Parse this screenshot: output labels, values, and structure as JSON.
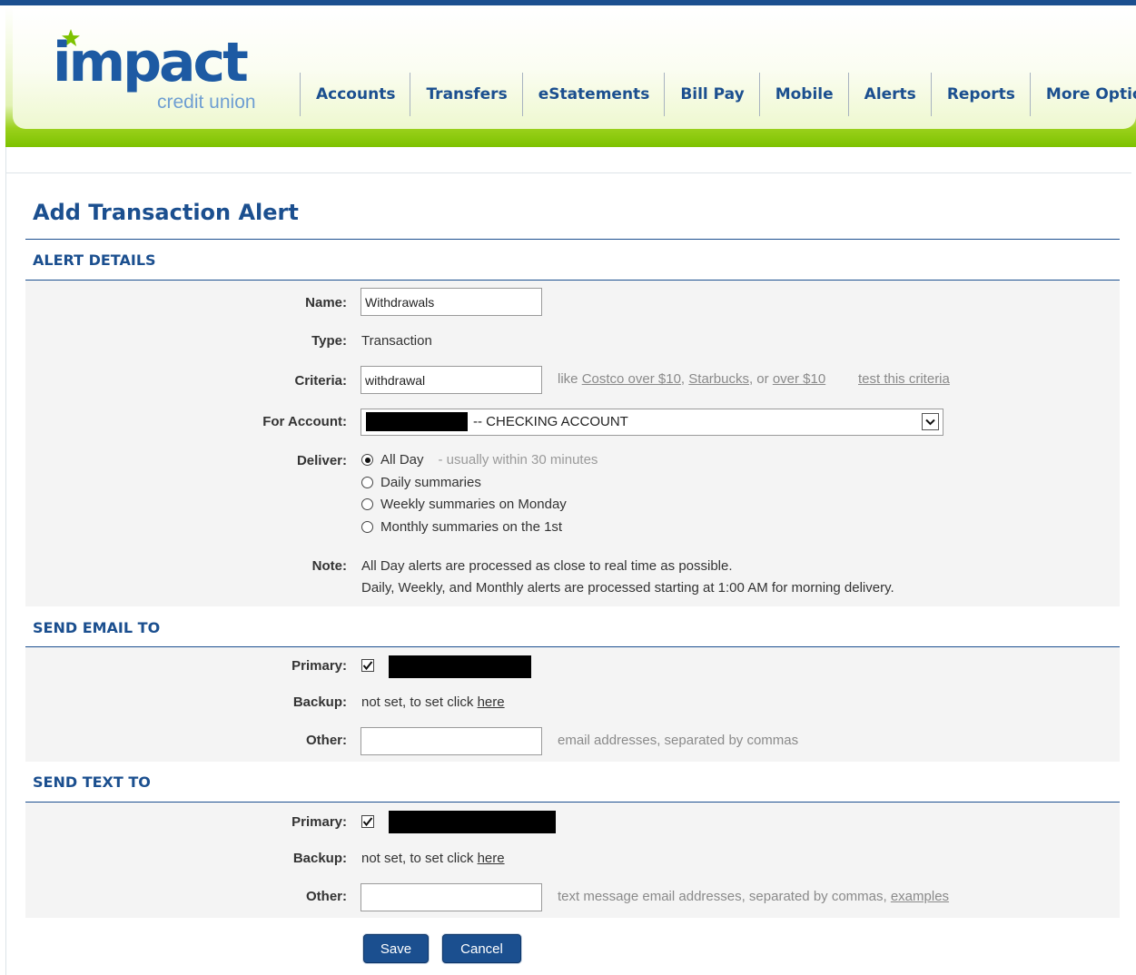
{
  "logo": {
    "word": "impact",
    "sub": "credit union"
  },
  "nav": [
    "Accounts",
    "Transfers",
    "eStatements",
    "Bill Pay",
    "Mobile",
    "Alerts",
    "Reports",
    "More Options"
  ],
  "page_title": "Add Transaction Alert",
  "alert_details": {
    "section_title": "ALERT DETAILS",
    "name_label": "Name:",
    "name_value": "Withdrawals",
    "type_label": "Type:",
    "type_value": "Transaction",
    "criteria_label": "Criteria:",
    "criteria_value": "withdrawal",
    "criteria_hint": {
      "like": "like ",
      "ex1": "Costco over $10",
      "sep1": ", ",
      "ex2": "Starbucks",
      "sep2": ", or ",
      "ex3": "over $10",
      "test": "test this criteria"
    },
    "account_label": "For Account:",
    "account_value": "--     CHECKING ACCOUNT",
    "deliver_label": "Deliver:",
    "deliver_options": [
      {
        "label": "All Day",
        "note": "- usually within 30 minutes",
        "selected": true
      },
      {
        "label": "Daily summaries",
        "selected": false
      },
      {
        "label": "Weekly summaries on Monday",
        "selected": false
      },
      {
        "label": "Monthly summaries on the 1st",
        "selected": false
      }
    ],
    "note_label": "Note:",
    "note_line1": "All Day alerts are processed as close to real time as possible.",
    "note_line2": "Daily, Weekly, and Monthly alerts are processed starting at 1:00 AM for morning delivery."
  },
  "email": {
    "section_title": "SEND EMAIL TO",
    "primary_label": "Primary:",
    "primary_checked": true,
    "backup_label": "Backup:",
    "backup_text": "not set, to set click ",
    "backup_link": "here",
    "other_label": "Other:",
    "other_value": "",
    "other_hint": "email addresses, separated by commas"
  },
  "text": {
    "section_title": "SEND TEXT TO",
    "primary_label": "Primary:",
    "primary_checked": true,
    "backup_label": "Backup:",
    "backup_text": "not set, to set click ",
    "backup_link": "here",
    "other_label": "Other:",
    "other_value": "",
    "other_hint": "text message email addresses, separated by commas, ",
    "other_hint_link": "examples"
  },
  "buttons": {
    "save": "Save",
    "cancel": "Cancel"
  },
  "colors": {
    "brand_blue": "#1b4f8f",
    "brand_green": "#7dc200",
    "panel_bg": "#f4f4f4"
  }
}
